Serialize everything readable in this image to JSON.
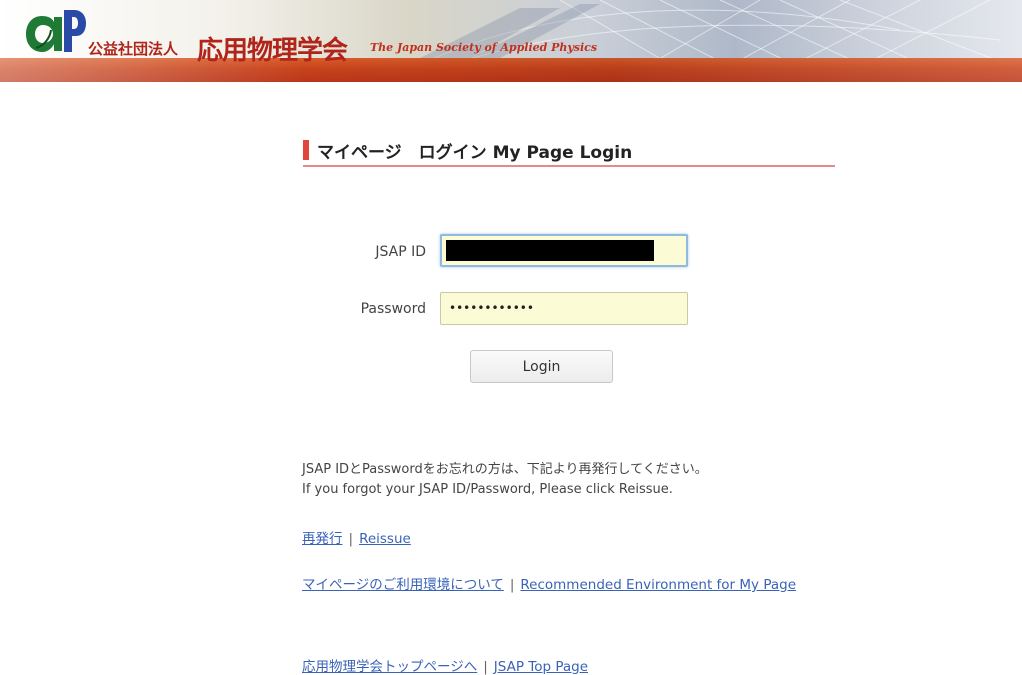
{
  "header": {
    "logo_text": "AP",
    "org_prefix": "公益社団法人",
    "org_name": "応用物理学会",
    "org_english": "The Japan Society of Applied Physics",
    "accent_color": "#b0241a",
    "band_color": "#c8431c"
  },
  "login": {
    "title": "マイページ　ログイン My Page Login",
    "jsap_id_label": "JSAP ID",
    "jsap_id_value": "",
    "password_label": "Password",
    "password_value": "••••••••••••",
    "login_button": "Login"
  },
  "help": {
    "line1": "JSAP IDとPasswordをお忘れの方は、下記より再発行してください。",
    "line2": "If you forgot your JSAP ID/Password, Please click Reissue."
  },
  "links": {
    "reissue_jp": "再発行",
    "reissue_en": "Reissue",
    "env_jp": "マイページのご利用環境について",
    "env_en": "Recommended Environment for My Page",
    "top_jp": "応用物理学会トップページへ",
    "top_en": "JSAP Top Page",
    "separator": "|"
  },
  "icons": {
    "logo": "jsap-logo-icon"
  }
}
